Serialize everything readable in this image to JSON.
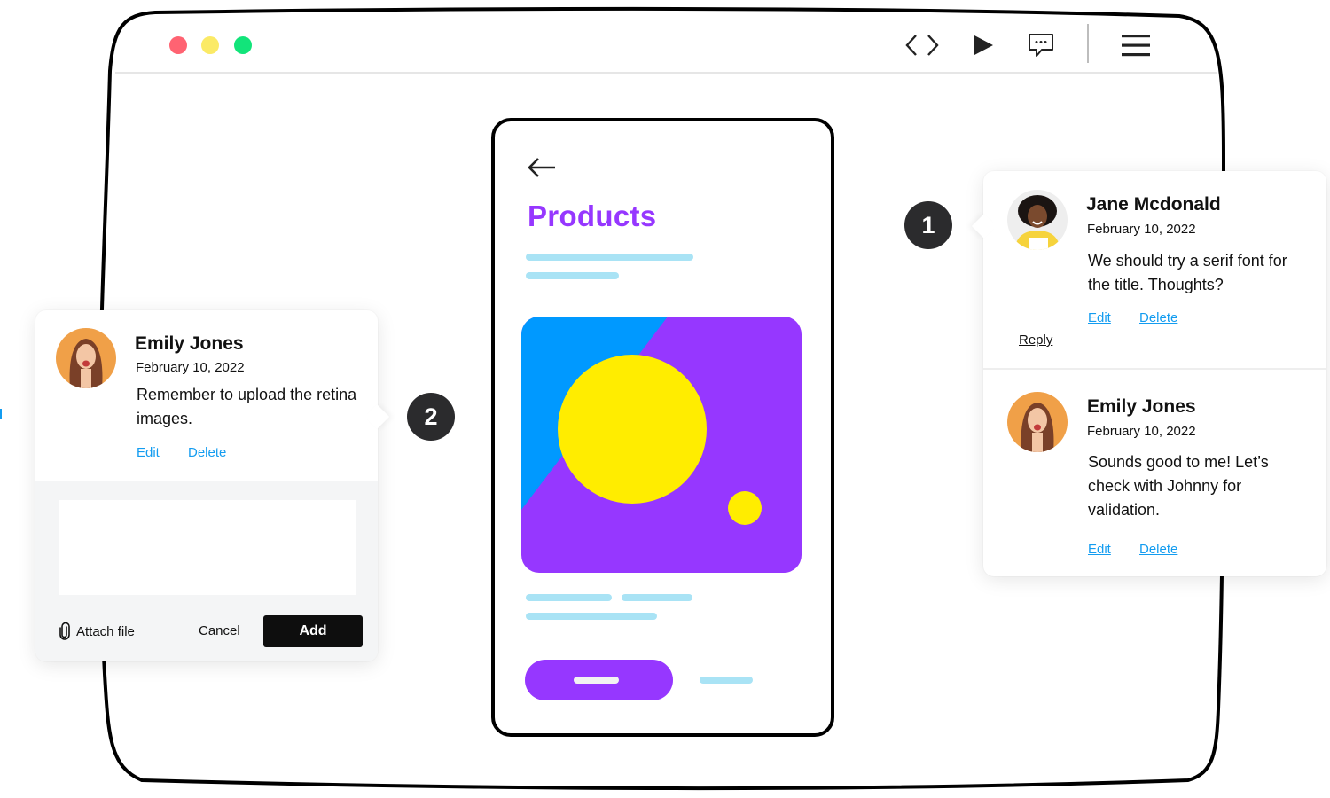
{
  "window": {
    "traffic_lights": {
      "close": "#ff6372",
      "minimize": "#fbea66",
      "maximize": "#12e47a"
    },
    "toolbar": [
      {
        "id": "code",
        "icon": "code-brackets-icon"
      },
      {
        "id": "play",
        "icon": "play-icon"
      },
      {
        "id": "comment",
        "icon": "comment-bubble-icon"
      },
      {
        "id": "menu",
        "icon": "hamburger-menu-icon"
      }
    ]
  },
  "phone": {
    "back_icon": "arrow-left-icon",
    "title": "Products",
    "accent": "#9637ff",
    "skeleton_color": "#a9e3f5",
    "hero_colors": {
      "blue": "#0099ff",
      "purple": "#9637ff",
      "yellow": "#ffed00"
    }
  },
  "markers": [
    {
      "number": "1"
    },
    {
      "number": "2"
    }
  ],
  "thread_left": {
    "comment": {
      "author": "Emily Jones",
      "date": "February 10, 2022",
      "text": "Remember to upload the retina images.",
      "edit_label": "Edit",
      "delete_label": "Delete"
    },
    "reply_box": {
      "value": "",
      "placeholder": "",
      "attach_label": "Attach file",
      "cancel_label": "Cancel",
      "add_label": "Add"
    }
  },
  "thread_right": {
    "comments": [
      {
        "author": "Jane Mcdonald",
        "date": "February 10, 2022",
        "text": "We should try a serif font for the title. Thoughts?",
        "edit_label": "Edit",
        "delete_label": "Delete",
        "reply_label": "Reply"
      },
      {
        "author": "Emily Jones",
        "date": "February 10, 2022",
        "text": "Sounds good to me! Let’s check with Johnny for validation.",
        "edit_label": "Edit",
        "delete_label": "Delete"
      }
    ]
  },
  "colors": {
    "link": "#139cf0",
    "marker": "#2b2b2d",
    "add_button": "#0e0e0e"
  }
}
